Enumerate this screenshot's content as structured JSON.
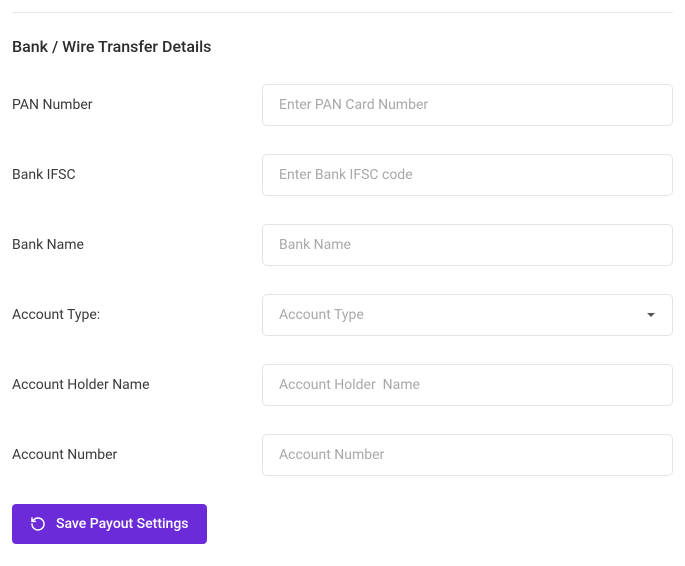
{
  "section": {
    "title": "Bank / Wire Transfer Details"
  },
  "fields": {
    "pan": {
      "label": "PAN Number",
      "placeholder": "Enter PAN Card Number",
      "value": ""
    },
    "ifsc": {
      "label": "Bank IFSC",
      "placeholder": "Enter Bank IFSC code",
      "value": ""
    },
    "bank_name": {
      "label": "Bank Name",
      "placeholder": "Bank Name",
      "value": ""
    },
    "account_type": {
      "label": "Account Type:",
      "placeholder": "Account Type",
      "value": ""
    },
    "account_holder": {
      "label": "Account Holder Name",
      "placeholder": "Account Holder  Name",
      "value": ""
    },
    "account_number": {
      "label": "Account Number",
      "placeholder": "Account Number",
      "value": ""
    }
  },
  "actions": {
    "save_label": "Save Payout Settings"
  }
}
